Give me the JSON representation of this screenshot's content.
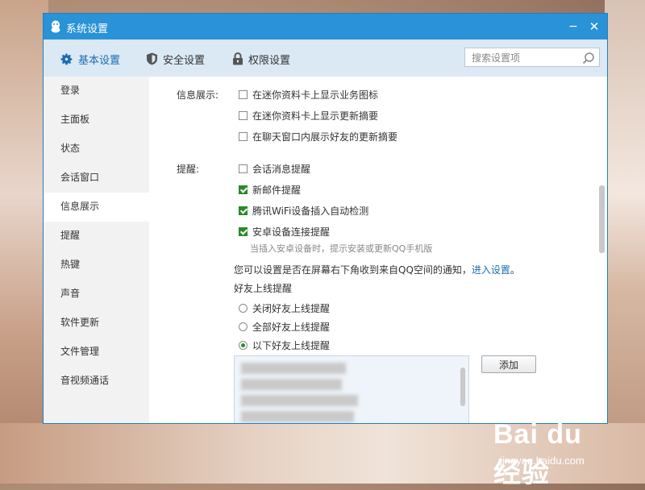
{
  "window": {
    "title": "系统设置",
    "minimize_symbol": "−",
    "close_symbol": "✕"
  },
  "tabs": [
    {
      "label": "基本设置",
      "icon": "gear-icon",
      "active": true
    },
    {
      "label": "安全设置",
      "icon": "shield-icon",
      "active": false
    },
    {
      "label": "权限设置",
      "icon": "lock-icon",
      "active": false
    }
  ],
  "search": {
    "placeholder": "搜索设置项"
  },
  "sidebar": {
    "items": [
      {
        "label": "登录"
      },
      {
        "label": "主面板"
      },
      {
        "label": "状态"
      },
      {
        "label": "会话窗口"
      },
      {
        "label": "信息展示",
        "active": true
      },
      {
        "label": "提醒"
      },
      {
        "label": "热键"
      },
      {
        "label": "声音"
      },
      {
        "label": "软件更新"
      },
      {
        "label": "文件管理"
      },
      {
        "label": "音视频通话"
      }
    ]
  },
  "info_display": {
    "label": "信息展示:",
    "options": [
      {
        "label": "在迷你资料卡上显示业务图标",
        "checked": false
      },
      {
        "label": "在迷你资料卡上显示更新摘要",
        "checked": false
      },
      {
        "label": "在聊天窗口内展示好友的更新摘要",
        "checked": false
      }
    ]
  },
  "reminder": {
    "label": "提醒:",
    "options": [
      {
        "label": "会话消息提醒",
        "checked": false
      },
      {
        "label": "新邮件提醒",
        "checked": true
      },
      {
        "label": "腾讯WiFi设备插入自动检测",
        "checked": true
      },
      {
        "label": "安卓设备连接提醒",
        "checked": true
      }
    ],
    "android_hint": "当插入安卓设备时，提示安装或更新QQ手机版",
    "qzone_text": "您可以设置是否在屏幕右下角收到来自QQ空间的通知，",
    "qzone_link": "进入设置",
    "qzone_suffix": "。",
    "friend_online_title": "好友上线提醒",
    "friend_online_options": [
      {
        "label": "关闭好友上线提醒",
        "selected": false
      },
      {
        "label": "全部好友上线提醒",
        "selected": false
      },
      {
        "label": "以下好友上线提醒",
        "selected": true
      }
    ],
    "add_button": "添加"
  },
  "watermark": {
    "main": "Bai du 经验",
    "sub": "jingyan.baidu.com"
  },
  "colors": {
    "titlebar": "#2a92d7",
    "tabbar": "#dbe9f5",
    "accent": "#1c6db1",
    "check": "#2a8a2a"
  }
}
